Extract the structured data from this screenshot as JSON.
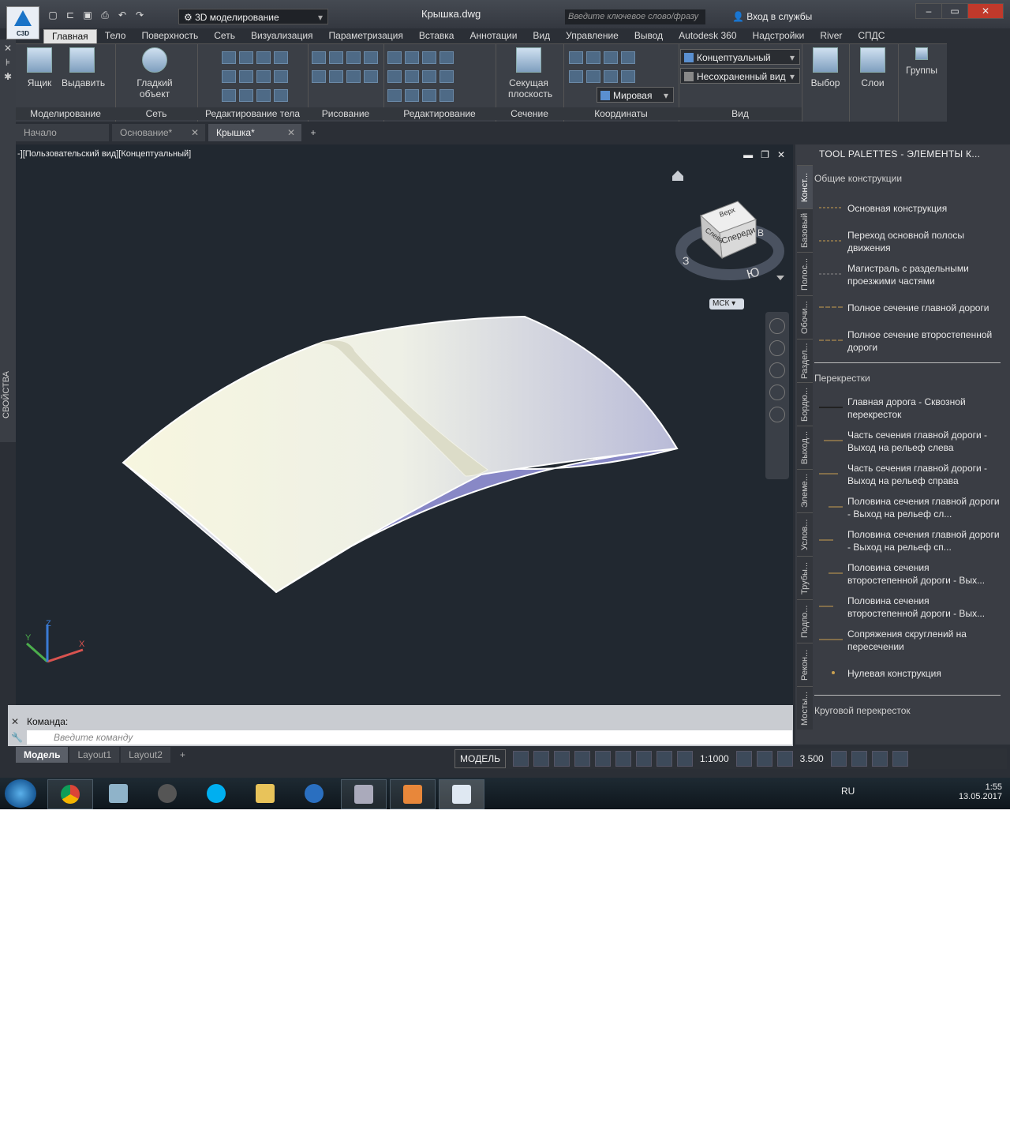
{
  "app": {
    "logo_label": "C3D",
    "workspace": "3D моделирование",
    "title": "Крышка.dwg",
    "search_placeholder": "Введите ключевое слово/фразу",
    "signin": "Вход в службы"
  },
  "ribbon_tabs": [
    "Главная",
    "Тело",
    "Поверхность",
    "Сеть",
    "Визуализация",
    "Параметризация",
    "Вставка",
    "Аннотации",
    "Вид",
    "Управление",
    "Вывод",
    "Autodesk 360",
    "Надстройки",
    "River",
    "СПДС"
  ],
  "ribbon": {
    "box_label": "Ящик",
    "extrude_label": "Выдавить",
    "smooth_label_1": "Гладкий",
    "smooth_label_2": "объект",
    "section_plane_1": "Секущая",
    "section_plane_2": "плоскость",
    "visual_style": "Концептуальный",
    "view_state": "Несохраненный вид",
    "ucs": "Мировая",
    "select_label": "Выбор",
    "layers_label": "Слои",
    "groups_label": "Группы",
    "panels": [
      "Моделирование",
      "Сеть",
      "Редактирование тела",
      "Рисование",
      "Редактирование",
      "Сечение",
      "Координаты",
      "Вид"
    ]
  },
  "doc_tabs": [
    {
      "label": "Начало"
    },
    {
      "label": "Основание*"
    },
    {
      "label": "Крышка*"
    }
  ],
  "left_bar_label": "СВОЙСТВА",
  "viewport": {
    "label": "-][Пользовательский вид][Концептуальный]",
    "viewcube_top": "Верх",
    "viewcube_front": "Спереди",
    "viewcube_left": "Слева",
    "compass_w": "З",
    "compass_s": "Ю",
    "compass_e": "В",
    "ucs_label": "МСК",
    "axis_x": "X",
    "axis_y": "Y",
    "axis_z": "Z"
  },
  "command": {
    "label": "Команда:",
    "placeholder": "Введите команду"
  },
  "layout_tabs": [
    "Модель",
    "Layout1",
    "Layout2"
  ],
  "status": {
    "model": "МОДЕЛЬ",
    "scale": "1:1000",
    "annotation": "3.500"
  },
  "palette": {
    "title": "TOOL PALETTES - ЭЛЕМЕНТЫ К...",
    "vtabs": [
      "Конст...",
      "Базовый",
      "Полос...",
      "Обочи...",
      "Раздел...",
      "Бордю...",
      "Выход...",
      "Элеме...",
      "Услов...",
      "Трубы...",
      "Подпо...",
      "Рекон...",
      "Мосты..."
    ],
    "section1": "Общие конструкции",
    "items1": [
      "Основная конструкция",
      "Переход основной полосы движения",
      "Магистраль с раздельными проезжими частями",
      "Полное сечение главной дороги",
      "Полное сечение второстепенной дороги"
    ],
    "section2": "Перекрестки",
    "items2": [
      "Главная дорога - Сквозной перекресток",
      "Часть сечения главной дороги - Выход на рельеф слева",
      "Часть сечения главной дороги - Выход на рельеф справа",
      "Половина сечения главной дороги - Выход на рельеф сл...",
      "Половина сечения главной дороги - Выход на рельеф сп...",
      "Половина сечения второстепенной дороги - Вых...",
      "Половина сечения второстепенной дороги - Вых...",
      "Сопряжения скруглений на пересечении",
      "Нулевая конструкция"
    ],
    "section3": "Круговой перекресток"
  },
  "taskbar": {
    "lang": "RU",
    "time": "1:55",
    "date": "13.05.2017"
  },
  "colors": {
    "surface_top": "#f6f5df",
    "surface_side": "#8686c4",
    "accent": "#1a73c7"
  }
}
